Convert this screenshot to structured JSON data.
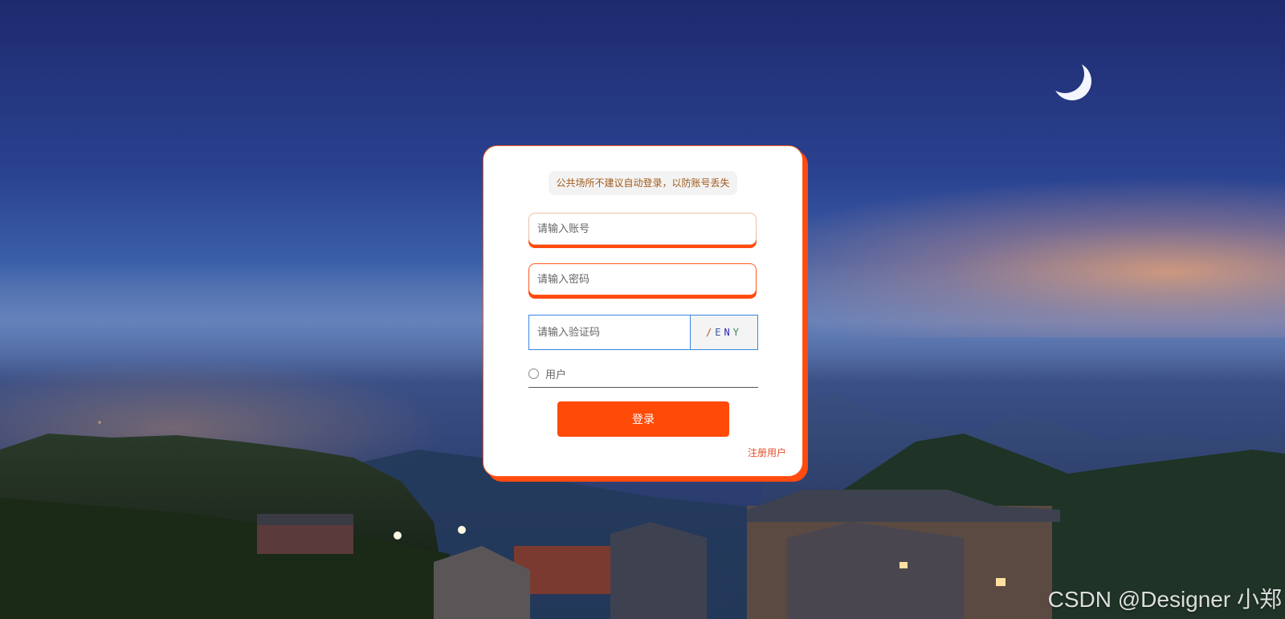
{
  "login": {
    "notice": "公共场所不建议自动登录，以防账号丢失",
    "account_placeholder": "请输入账号",
    "password_placeholder": "请输入密码",
    "captcha_placeholder": "请输入验证码",
    "captcha_text": [
      "/",
      "E",
      "N",
      "Y"
    ],
    "captcha_colors": [
      "#b05a2a",
      "#3a5a9a",
      "#2a2ab0",
      "#3a8a5a"
    ],
    "role_option": "用户",
    "role_selected": false,
    "submit_label": "登录",
    "register_label": "注册用户"
  },
  "watermark": "CSDN @Designer 小郑",
  "colors": {
    "accent": "#ff4a08",
    "card_border": "#ff5a1f",
    "captcha_border": "#3a86e0"
  }
}
